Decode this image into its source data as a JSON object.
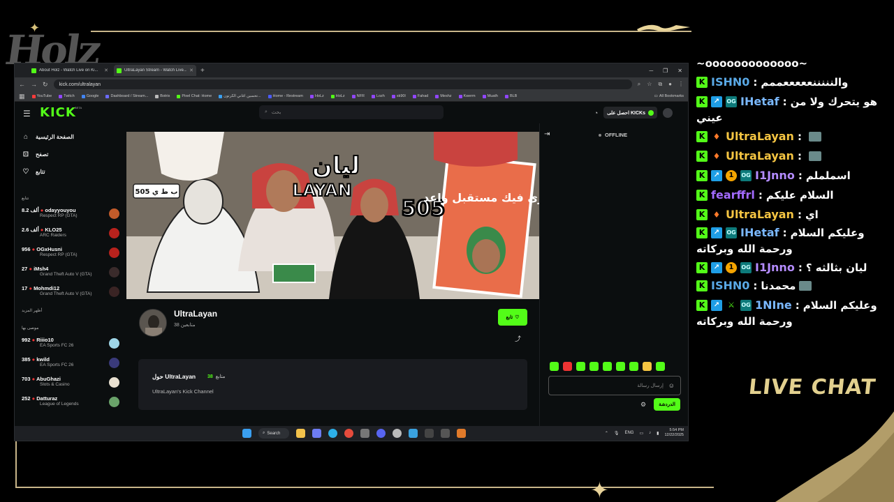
{
  "overlay": {
    "logo_text": "Holz",
    "live_chat_label": "LIVE CHAT"
  },
  "browser": {
    "tabs": [
      {
        "title": "About Holz - Watch Live on Ki...",
        "active": false
      },
      {
        "title": "UltraLayan Stream - Watch Live...",
        "active": true
      }
    ],
    "url": "kick.com/ultralayan",
    "bookmarks": [
      "YouTube",
      "Twitch",
      "Google",
      "Dashboard / Stream...",
      "Botrix",
      "Pixel Chat: Home",
      "تحسين اغاني الكرتون...",
      "Home - Restream",
      "HoLz",
      "HoLz",
      "NFR",
      "Lozh",
      "sk90l",
      "Fahad",
      "Meshz",
      "Kwerm",
      "Muath",
      "BLB"
    ],
    "bookmarks_right": "All Bookmarks"
  },
  "kick": {
    "logo": "KICK",
    "logo_badge": "BETA",
    "search_placeholder": "بحث",
    "get_kicks": "احصل على KICKs",
    "nav": [
      {
        "label": "الصفحة الرئيسية",
        "icon": "home-icon"
      },
      {
        "label": "تصفح",
        "icon": "browse-icon"
      },
      {
        "label": "تتابع",
        "icon": "heart-icon"
      }
    ],
    "following_title": "تتابع",
    "following": [
      {
        "name": "odayyouyou",
        "count": "8.2 ألف",
        "game": "Respect RP (GTA)"
      },
      {
        "name": "KLO25",
        "count": "2.6 ألف",
        "game": "ARC Raiders"
      },
      {
        "name": "OGxHusni",
        "count": "956",
        "game": "Respect RP (GTA)"
      },
      {
        "name": "iMsh4",
        "count": "27",
        "game": "Grand Theft Auto V (GTA)"
      },
      {
        "name": "Mohmdi12",
        "count": "17",
        "game": "Grand Theft Auto V (GTA)"
      }
    ],
    "show_more": "أظهر المزيد",
    "recommended_title": "موصى بها",
    "recommended": [
      {
        "name": "Riiio10",
        "count": "992",
        "game": "EA Sports FC 26"
      },
      {
        "name": "kwild",
        "count": "385",
        "game": "EA Sports FC 26"
      },
      {
        "name": "AbuGhazi",
        "count": "703",
        "game": "Slots & Casino"
      },
      {
        "name": "Datturaz",
        "count": "252",
        "game": "League of Legends"
      }
    ],
    "banner": {
      "title_ar": "ليان",
      "title_en": "LAYAN",
      "number": "505",
      "poster_text": "نرى فيك مستقبل واعد",
      "plate_text": "505 ب ط ي"
    },
    "channel": {
      "name": "UltraLayan",
      "followers": "38 متابعين",
      "follow_label": "تابع",
      "about_title": "حول UltraLayan",
      "about_followers_num": "38",
      "about_followers_label": "متابع",
      "about_desc": "UltraLayan's Kick Channel"
    },
    "chat": {
      "status": "OFFLINE",
      "input_placeholder": "إرسال رسالة",
      "chat_button": "الدردشة"
    }
  },
  "taskbar": {
    "search_label": "Search",
    "lang": "ENG",
    "time": "5:54 PM",
    "date": "12/22/2025"
  },
  "live_chat": [
    {
      "user": "",
      "text": "~ooooooooooooo~",
      "user_color": "#ffffff",
      "badges": []
    },
    {
      "user": "ISHN0",
      "text": "والنننننعععععممم",
      "user_color": "#5aa9e6",
      "badges": [
        "kick"
      ]
    },
    {
      "user": "IHetaf",
      "text": "هو يتحرك ولا من",
      "cont": "عيني",
      "user_color": "#7ab8ff",
      "badges": [
        "kick",
        "arrow",
        "og"
      ]
    },
    {
      "user": "UltraLayan",
      "text": "",
      "user_color": "#f5c542",
      "badges": [
        "kick",
        "fire"
      ],
      "emote": true
    },
    {
      "user": "UltraLayan",
      "text": "",
      "user_color": "#f5c542",
      "badges": [
        "kick",
        "fire"
      ],
      "emote": true
    },
    {
      "user": "I1Jnno",
      "text": "اسململم",
      "user_color": "#b48cff",
      "badges": [
        "kick",
        "arrow",
        "one",
        "og"
      ]
    },
    {
      "user": "fearffrl",
      "text": "السلام عليكم",
      "user_color": "#a36bff",
      "badges": [
        "kick"
      ]
    },
    {
      "user": "UltraLayan",
      "text": "اي",
      "user_color": "#f5c542",
      "badges": [
        "kick",
        "fire"
      ]
    },
    {
      "user": "IHetaf",
      "text": "وعليكم السلام",
      "cont": "ورحمة الله وبركاته",
      "user_color": "#7ab8ff",
      "badges": [
        "kick",
        "arrow",
        "og"
      ]
    },
    {
      "user": "I1Jnno",
      "text": "ليان بثالثه ؟",
      "user_color": "#b48cff",
      "badges": [
        "kick",
        "arrow",
        "one",
        "og"
      ]
    },
    {
      "user": "ISHN0",
      "text": "محمدنا",
      "user_color": "#5aa9e6",
      "badges": [
        "kick"
      ],
      "emote": true
    },
    {
      "user": "1NIne",
      "text": "وعليكم السلام",
      "cont": "ورحمة الله وبركاته",
      "user_color": "#7ab8ff",
      "badges": [
        "kick",
        "arrow",
        "mod",
        "og"
      ]
    }
  ],
  "colors": {
    "kick_green": "#53fc18",
    "gold": "#d8c27b"
  }
}
